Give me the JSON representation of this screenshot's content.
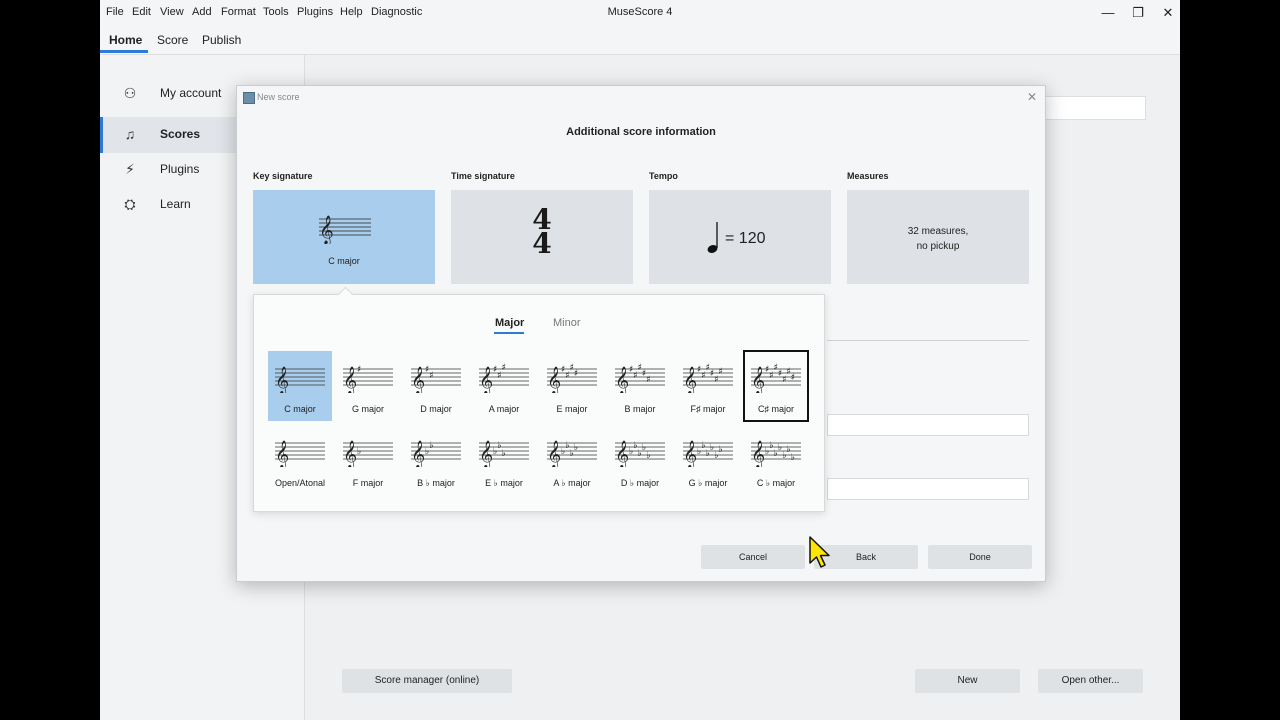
{
  "window": {
    "title": "MuseScore 4",
    "menu": [
      "File",
      "Edit",
      "View",
      "Add",
      "Format",
      "Tools",
      "Plugins",
      "Help",
      "Diagnostic"
    ],
    "controls": [
      "—",
      "❐",
      "✕"
    ]
  },
  "top_tabs": [
    "Home",
    "Score",
    "Publish"
  ],
  "sidebar": {
    "items": [
      {
        "label": "My account",
        "icon": "user-icon",
        "glyph": "⚇"
      },
      {
        "label": "Scores",
        "icon": "music-note-icon",
        "glyph": "♫"
      },
      {
        "label": "Plugins",
        "icon": "plug-icon",
        "glyph": "⚡"
      },
      {
        "label": "Learn",
        "icon": "graduation-cap-icon",
        "glyph": "⛭"
      }
    ],
    "active_index": 1
  },
  "background": {
    "buttons": {
      "score_manager": "Score manager (online)",
      "new": "New",
      "open_other": "Open other..."
    }
  },
  "dialog": {
    "title": "New score",
    "close": "✕",
    "heading": "Additional score information",
    "sections": {
      "key": {
        "label": "Key signature",
        "value": "C major"
      },
      "time": {
        "label": "Time signature",
        "numerator": "4",
        "denominator": "4"
      },
      "tempo": {
        "label": "Tempo",
        "value": "= 120"
      },
      "measures": {
        "label": "Measures",
        "line1": "32 measures,",
        "line2": "no pickup"
      }
    },
    "buttons": {
      "cancel": "Cancel",
      "back": "Back",
      "done": "Done"
    }
  },
  "key_popup": {
    "tabs": {
      "major": "Major",
      "minor": "Minor"
    },
    "active_tab": "major",
    "row1": [
      {
        "label": "C major",
        "sharps": 0,
        "flats": 0
      },
      {
        "label": "G major",
        "sharps": 1,
        "flats": 0
      },
      {
        "label": "D major",
        "sharps": 2,
        "flats": 0
      },
      {
        "label": "A major",
        "sharps": 3,
        "flats": 0
      },
      {
        "label": "E major",
        "sharps": 4,
        "flats": 0
      },
      {
        "label": "B major",
        "sharps": 5,
        "flats": 0
      },
      {
        "label": "F♯ major",
        "sharps": 6,
        "flats": 0
      },
      {
        "label": "C♯ major",
        "sharps": 7,
        "flats": 0
      }
    ],
    "row2": [
      {
        "label": "Open/Atonal",
        "sharps": 0,
        "flats": 0
      },
      {
        "label": "F major",
        "sharps": 0,
        "flats": 1
      },
      {
        "label": "B ♭ major",
        "sharps": 0,
        "flats": 2
      },
      {
        "label": "E ♭  major",
        "sharps": 0,
        "flats": 3
      },
      {
        "label": "A ♭ major",
        "sharps": 0,
        "flats": 4
      },
      {
        "label": "D ♭  major",
        "sharps": 0,
        "flats": 5
      },
      {
        "label": "G ♭  major",
        "sharps": 0,
        "flats": 6
      },
      {
        "label": "C ♭  major",
        "sharps": 0,
        "flats": 7
      }
    ],
    "selected": "C major",
    "focused": "C♯ major"
  },
  "colors": {
    "accent": "#2e7ad4",
    "selected_bg": "#a9cdec",
    "card_bg": "#dee1e5",
    "cursor": "#ffe600"
  }
}
